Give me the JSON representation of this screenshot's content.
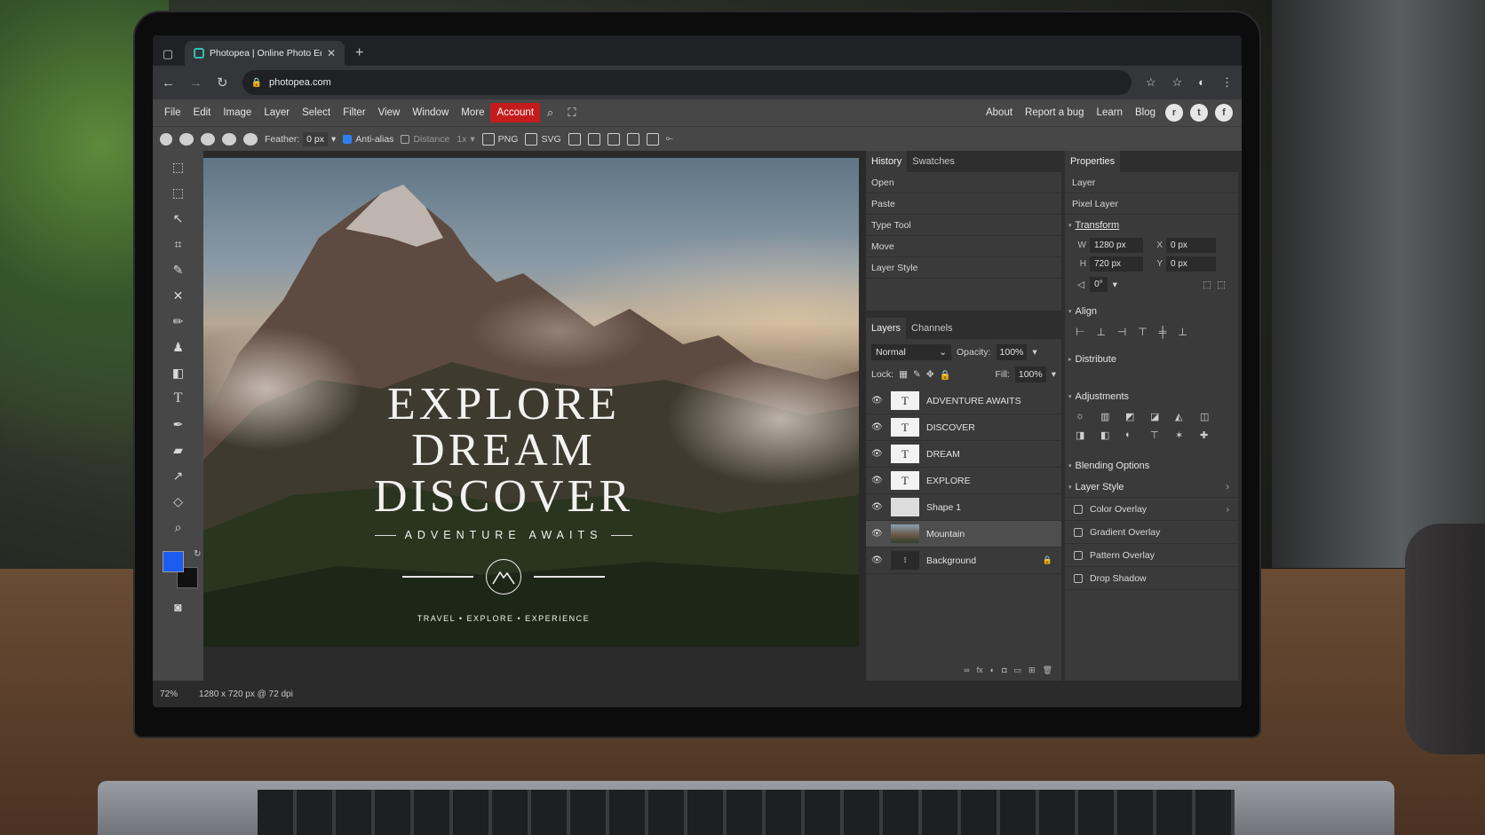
{
  "browser": {
    "tab_title": "Photopea | Online Photo Editor",
    "url": "photopea.com"
  },
  "menu": {
    "items": [
      "File",
      "Edit",
      "Image",
      "Layer",
      "Select",
      "Filter",
      "View",
      "Window",
      "More"
    ],
    "account": "Account",
    "right_links": [
      "About",
      "Report a bug",
      "Learn",
      "Blog"
    ]
  },
  "options": {
    "feather_label": "Feather:",
    "feather_value": "0 px",
    "antialias_label": "Anti-alias",
    "distance_label": "Distance",
    "ratio_value": "1x",
    "png_label": "PNG",
    "svg_label": "SVG"
  },
  "canvas": {
    "line1": "EXPLORE",
    "line2": "DREAM",
    "line3": "DISCOVER",
    "tagline": "ADVENTURE AWAITS",
    "footer": "TRAVEL • EXPLORE • EXPERIENCE"
  },
  "history_panel": {
    "tabs": [
      "History",
      "Swatches"
    ],
    "items": [
      "Open",
      "Paste",
      "Type Tool",
      "Move",
      "Layer Style"
    ]
  },
  "layers_panel": {
    "tabs": [
      "Layers",
      "Channels"
    ],
    "blend_mode": "Normal",
    "opacity_label": "Opacity:",
    "opacity_value": "100%",
    "lock_label": "Lock:",
    "fill_label": "Fill:",
    "fill_value": "100%",
    "layers": [
      {
        "name": "ADVENTURE AWAITS",
        "thumb": "T"
      },
      {
        "name": "DISCOVER",
        "thumb": "T"
      },
      {
        "name": "DREAM",
        "thumb": "T"
      },
      {
        "name": "EXPLORE",
        "thumb": "T"
      },
      {
        "name": "Shape 1",
        "thumb": ""
      },
      {
        "name": "Mountain",
        "thumb": ""
      },
      {
        "name": "Background",
        "thumb": ""
      }
    ],
    "selected": "Mountain"
  },
  "properties_panel": {
    "tab": "Properties",
    "layer_label": "Layer",
    "layer_type": "Pixel Layer",
    "transform_title": "Transform",
    "w_label": "W",
    "w_value": "1280 px",
    "x_label": "X",
    "x_value": "0 px",
    "h_label": "H",
    "h_value": "720 px",
    "y_label": "Y",
    "y_value": "0 px",
    "rotation_value": "0°",
    "align_title": "Align",
    "distribute_title": "Distribute",
    "adjustments_title": "Adjustments",
    "blending_title": "Blending Options",
    "layer_style_title": "Layer Style",
    "styles": [
      "Color Overlay",
      "Gradient Overlay",
      "Pattern Overlay",
      "Drop Shadow"
    ]
  },
  "status": {
    "zoom": "72%",
    "doc_info": "1280 x 720 px @ 72 dpi"
  },
  "colors": {
    "foreground": "#1d5cf0",
    "background": "#111111",
    "account_red": "#c41c1c"
  }
}
